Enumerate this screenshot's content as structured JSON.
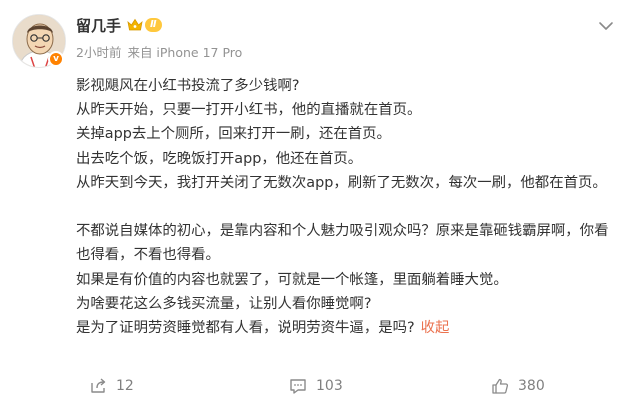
{
  "author": {
    "name": "留几手",
    "level_badge": "Ⅱ",
    "verified_mark": "v",
    "avatar_icon": "cartoon-avatar-icon",
    "crown_icon": "crown-icon"
  },
  "meta": {
    "time": "2小时前",
    "source": "来自 iPhone 17 Pro"
  },
  "content": {
    "lines": [
      "影视飓风在小红书投流了多少钱啊?",
      "从昨天开始，只要一打开小红书，他的直播就在首页。",
      "关掉app去上个厕所，回来打开一刷，还在首页。",
      "出去吃个饭，吃晚饭打开app，他还在首页。",
      "从昨天到今天，我打开关闭了无数次app，刷新了无数次，每次一刷，他都在首页。",
      "",
      "不都说自媒体的初心，是靠内容和个人魅力吸引观众吗？原来是靠砸钱霸屏啊，你看也得看，不看也得看。",
      "如果是有价值的内容也就罢了，可就是一个帐篷，里面躺着睡大觉。",
      "为啥要花这么多钱买流量，让别人看你睡觉啊?",
      "是为了证明劳资睡觉都有人看，说明劳资牛逼，是吗?"
    ],
    "collapse_label": "收起"
  },
  "actions": {
    "repost_count": "12",
    "comment_count": "103",
    "like_count": "380"
  },
  "colors": {
    "link": "#eb7350",
    "meta": "#939393",
    "verified": "#ff8200",
    "level_badge": "#ffc83d"
  }
}
